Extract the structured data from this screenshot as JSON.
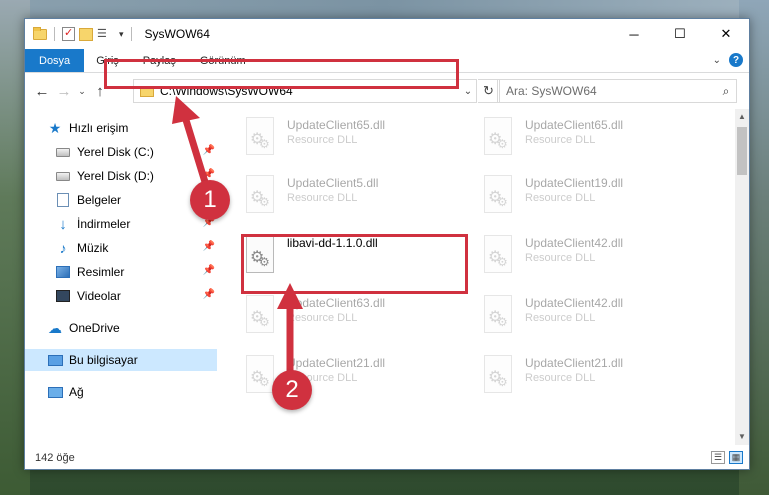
{
  "window": {
    "title": "SysWOW64",
    "controls": {
      "minimize": "─",
      "maximize": "☐",
      "close": "✕"
    }
  },
  "ribbon": {
    "tabs": [
      "Dosya",
      "Giriş",
      "Paylaş",
      "Görünüm"
    ],
    "collapse_icon": "chevron-up-icon",
    "help_label": "?"
  },
  "navigation": {
    "back": "←",
    "forward": "→",
    "recent": "⌄",
    "up": "↑",
    "address": "C:\\Windows\\SysWOW64",
    "search_placeholder": "Ara: SysWOW64"
  },
  "sidebar": {
    "items": [
      {
        "label": "Hızlı erişim",
        "icon": "star-icon"
      },
      {
        "label": "Yerel Disk (C:)",
        "icon": "drive-icon",
        "pinned": true
      },
      {
        "label": "Yerel Disk (D:)",
        "icon": "drive-icon",
        "pinned": true
      },
      {
        "label": "Belgeler",
        "icon": "documents-icon",
        "pinned": true
      },
      {
        "label": "İndirmeler",
        "icon": "downloads-icon",
        "pinned": true
      },
      {
        "label": "Müzik",
        "icon": "music-icon",
        "pinned": true
      },
      {
        "label": "Resimler",
        "icon": "pictures-icon",
        "pinned": true
      },
      {
        "label": "Videolar",
        "icon": "videos-icon",
        "pinned": true
      },
      {
        "label": "OneDrive",
        "icon": "onedrive-icon"
      },
      {
        "label": "Bu bilgisayar",
        "icon": "this-pc-icon",
        "selected": true
      },
      {
        "label": "Ağ",
        "icon": "network-icon"
      }
    ]
  },
  "files": [
    {
      "name": "UpdateClient65.dll",
      "desc": "Resource DLL",
      "faded": true
    },
    {
      "name": "UpdateClient65.dll",
      "desc": "Resource DLL",
      "faded": true
    },
    {
      "name": "UpdateClient5.dll",
      "desc": "Resource DLL",
      "faded": true
    },
    {
      "name": "UpdateClient19.dll",
      "desc": "Resource DLL",
      "faded": true
    },
    {
      "name": "libavi-dd-1.1.0.dll",
      "desc": "",
      "faded": false
    },
    {
      "name": "UpdateClient42.dll",
      "desc": "Resource DLL",
      "faded": true
    },
    {
      "name": "UpdateClient63.dll",
      "desc": "Resource DLL",
      "faded": true
    },
    {
      "name": "UpdateClient42.dll",
      "desc": "Resource DLL",
      "faded": true
    },
    {
      "name": "UpdateClient21.dll",
      "desc": "Resource DLL",
      "faded": true
    },
    {
      "name": "UpdateClient21.dll",
      "desc": "Resource DLL",
      "faded": true
    }
  ],
  "status": {
    "count": "142 öğe"
  },
  "annotations": {
    "step1": "1",
    "step2": "2",
    "color": "#d0313f"
  }
}
